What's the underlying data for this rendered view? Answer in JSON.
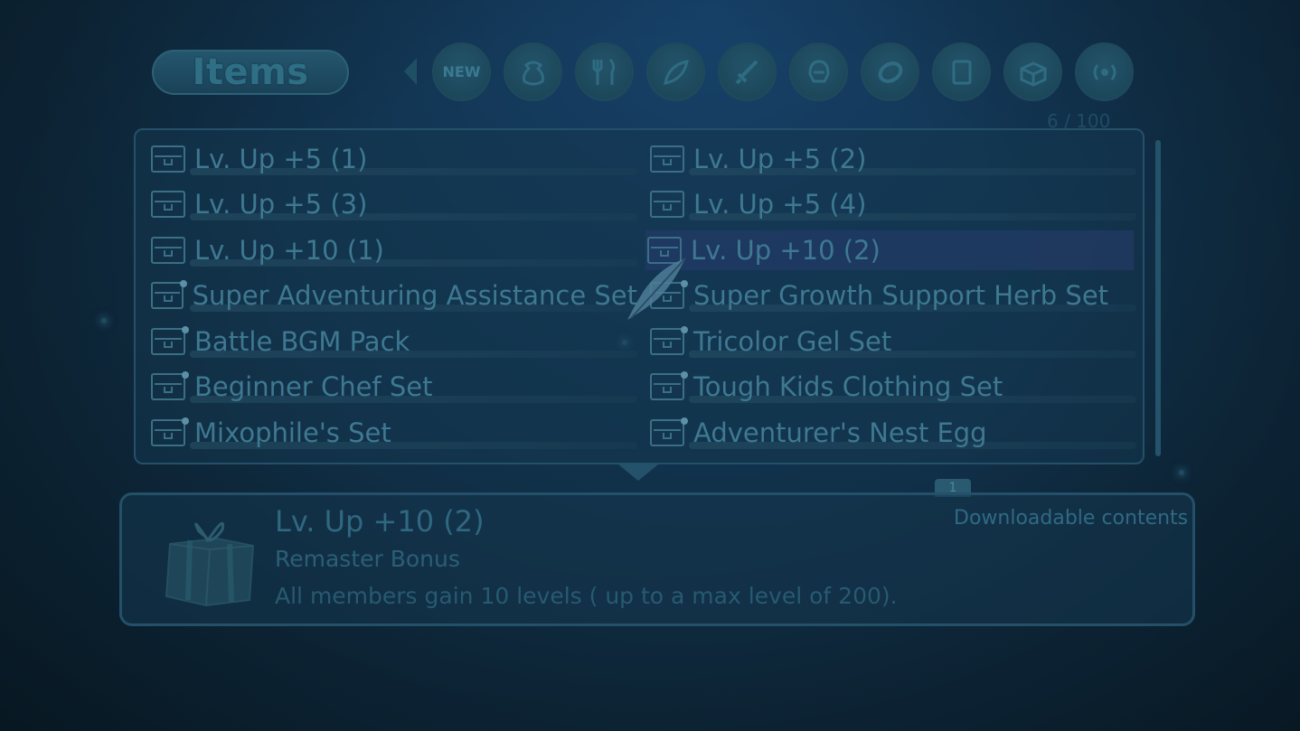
{
  "header": {
    "title": "Items",
    "categories": [
      {
        "name": "new",
        "label": "NEW"
      },
      {
        "name": "pouch",
        "label": ""
      },
      {
        "name": "food",
        "label": ""
      },
      {
        "name": "material",
        "label": ""
      },
      {
        "name": "weapon",
        "label": ""
      },
      {
        "name": "armor",
        "label": ""
      },
      {
        "name": "accessory",
        "label": ""
      },
      {
        "name": "book",
        "label": ""
      },
      {
        "name": "chest",
        "label": ""
      },
      {
        "name": "dlc",
        "label": ""
      }
    ],
    "count": "6 / 100"
  },
  "items": [
    {
      "label": "Lv. Up +5 (1)",
      "dot": false
    },
    {
      "label": "Lv. Up +5 (2)",
      "dot": false
    },
    {
      "label": "Lv. Up +5 (3)",
      "dot": false
    },
    {
      "label": "Lv. Up +5 (4)",
      "dot": false
    },
    {
      "label": "Lv. Up +10 (1)",
      "dot": false
    },
    {
      "label": "Lv. Up +10 (2)",
      "dot": false,
      "selected": true
    },
    {
      "label": "Super Adventuring Assistance Set",
      "dot": true
    },
    {
      "label": "Super Growth Support Herb Set",
      "dot": true
    },
    {
      "label": "Battle BGM Pack",
      "dot": true
    },
    {
      "label": "Tricolor Gel Set",
      "dot": true
    },
    {
      "label": "Beginner Chef Set",
      "dot": true
    },
    {
      "label": "Tough Kids Clothing Set",
      "dot": true
    },
    {
      "label": "Mixophile's Set",
      "dot": true
    },
    {
      "label": "Adventurer's Nest Egg",
      "dot": true
    }
  ],
  "description": {
    "page": "1",
    "title": "Lv. Up +10 (2)",
    "subtitle": "Remaster Bonus",
    "text": "All members gain 10 levels ( up to a max level of 200).",
    "source": "Downloadable contents"
  },
  "colors": {
    "background": "#123552",
    "selected_row": "#283c6e",
    "text": "#3e7891"
  }
}
